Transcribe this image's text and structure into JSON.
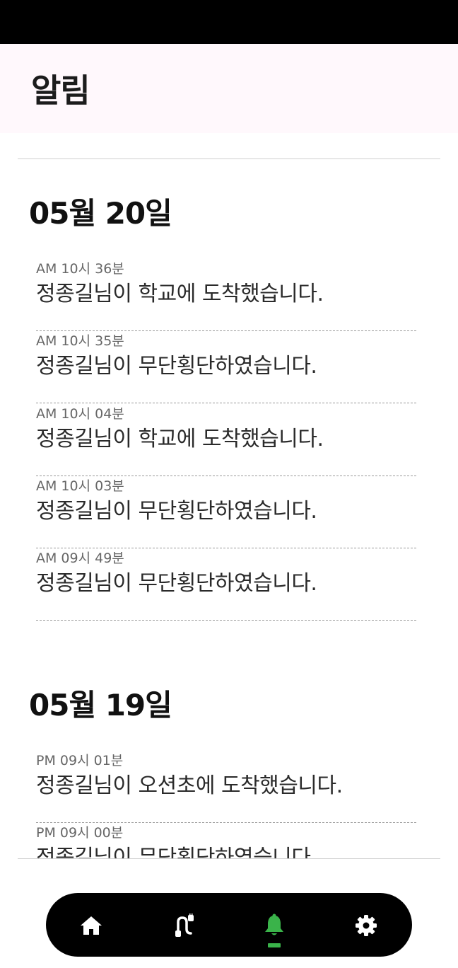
{
  "header": {
    "title": "알림"
  },
  "groups": [
    {
      "date": "05월 20일",
      "items": [
        {
          "time": "AM 10시 36분",
          "message": "정종길님이 학교에 도착했습니다."
        },
        {
          "time": "AM 10시 35분",
          "message": "정종길님이 무단횡단하였습니다."
        },
        {
          "time": "AM 10시 04분",
          "message": "정종길님이 학교에 도착했습니다."
        },
        {
          "time": "AM 10시 03분",
          "message": "정종길님이 무단횡단하였습니다."
        },
        {
          "time": "AM 09시 49분",
          "message": "정종길님이 무단횡단하였습니다."
        }
      ]
    },
    {
      "date": "05월 19일",
      "items": [
        {
          "time": "PM 09시 01분",
          "message": "정종길님이 오션초에 도착했습니다."
        },
        {
          "time": "PM 09시 00분",
          "message": "정종길님이 무단횡단하였습니다."
        }
      ]
    }
  ],
  "nav": {
    "items": [
      {
        "icon": "home-icon"
      },
      {
        "icon": "route-icon"
      },
      {
        "icon": "bell-icon",
        "active": true
      },
      {
        "icon": "gear-icon"
      }
    ],
    "active_color": "#3ab34a",
    "icon_color": "#ffffff"
  }
}
